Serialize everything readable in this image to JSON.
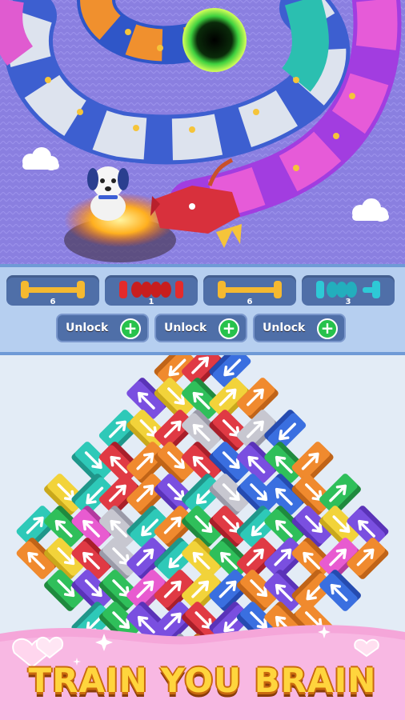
{
  "spool_slots": [
    {
      "color": "#f5b930",
      "style": "empty-spool",
      "count": "6"
    },
    {
      "color": "#e42b2b",
      "style": "wound-spool",
      "count": "1"
    },
    {
      "color": "#f5b930",
      "style": "empty-spool",
      "count": "6"
    },
    {
      "color": "#2ec9d6",
      "style": "wound-spool",
      "count": "3"
    }
  ],
  "unlock_buttons": [
    {
      "label": "Unlock"
    },
    {
      "label": "Unlock"
    },
    {
      "label": "Unlock"
    }
  ],
  "banner": {
    "title": "TRAIN YOU BRAIN"
  },
  "colors": {
    "scene_bg": "#8a7fe0",
    "slot_bg": "#4f6fa8",
    "board_bg": "#e3ecf6",
    "banner_pink": "#f7a8dc",
    "title_gold": "#ffd53d"
  },
  "icons": [
    "dog-character-icon",
    "dragon-head-icon",
    "black-hole-icon",
    "plus-icon",
    "cloud-icon",
    "heart-icon",
    "sparkle-icon"
  ]
}
